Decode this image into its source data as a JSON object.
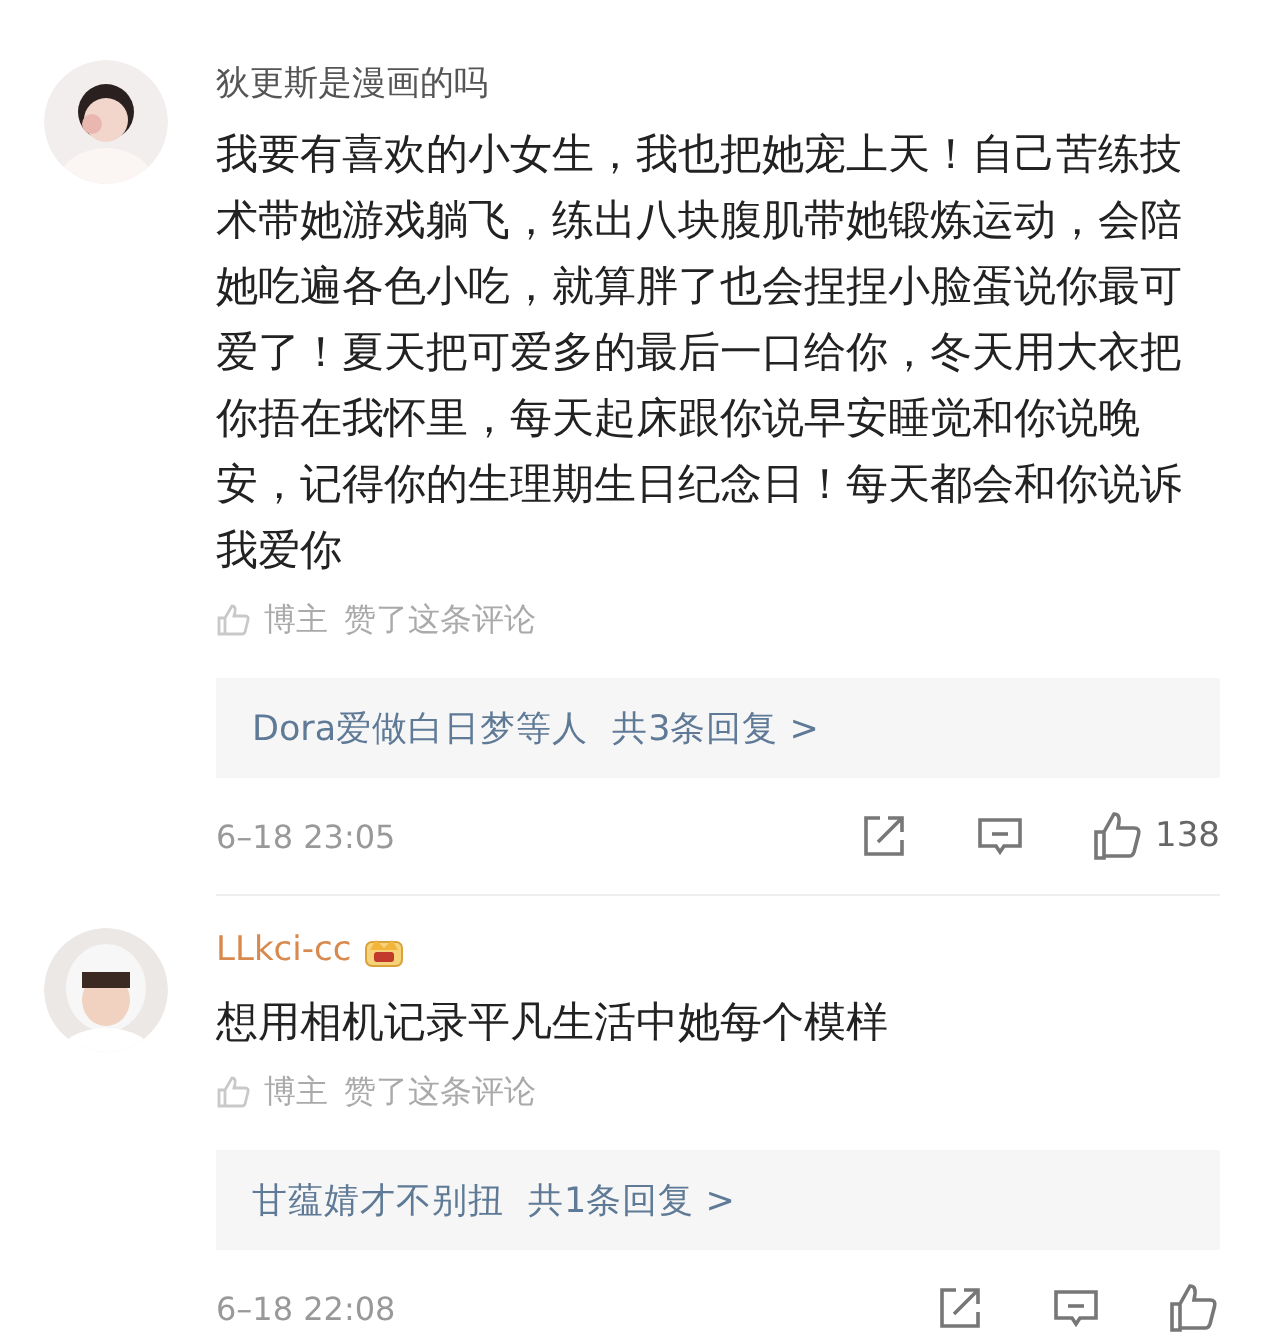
{
  "comments": [
    {
      "author": "狄更斯是漫画的吗",
      "vip": false,
      "text": "我要有喜欢的小女生，我也把她宠上天！自己苦练技术带她游戏躺飞，练出八块腹肌带她锻炼运动，会陪她吃遍各色小吃，就算胖了也会捏捏小脸蛋说你最可爱了！夏天把可爱多的最后一口给你，冬天用大衣把你捂在我怀里，每天起床跟你说早安睡觉和你说晚安，记得你的生理期生日纪念日！每天都会和你说诉我爱你",
      "liked_by": "博主",
      "liked_text": "赞了这条评论",
      "replies_by": "Dora爱做白日梦等人",
      "replies_count": "共3条回复 >",
      "time": "6–18 23:05",
      "likes": "138"
    },
    {
      "author": "LLkci-cc",
      "vip": true,
      "text": "想用相机记录平凡生活中她每个模样",
      "liked_by": "博主",
      "liked_text": "赞了这条评论",
      "replies_by": "甘蕴婧才不别扭",
      "replies_count": "共1条回复 >",
      "time": "6–18 22:08"
    }
  ]
}
